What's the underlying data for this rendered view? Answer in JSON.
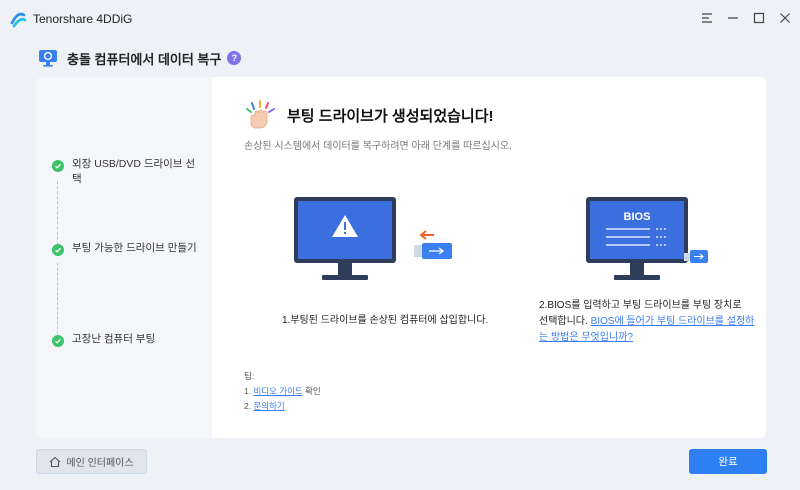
{
  "app": {
    "name": "Tenorshare 4DDiG"
  },
  "header": {
    "title": "충돌 컴퓨터에서 데이터 복구",
    "help": "?"
  },
  "sidebar": {
    "steps": [
      {
        "label": "외장 USB/DVD 드라이브 선택",
        "status": "completed"
      },
      {
        "label": "부팅 가능한 드라이브 만들기",
        "status": "completed"
      },
      {
        "label": "고장난 컴퓨터 부팅",
        "status": "completed"
      }
    ]
  },
  "main": {
    "title": "부팅 드라이브가 생성되었습니다!",
    "description": "손상된 시스템에서 데이터를 복구하려면 아래 단계를 따르십시오.",
    "instructions": [
      {
        "text": "1.부팅된 드라이브를 손상된 컴퓨터에 삽입합니다."
      },
      {
        "text_line1": "2.BIOS를 입력하고 부팅 드라이브를 부팅 장치로",
        "text_line2": "선택합니다.",
        "link": "BIOS에 들어가 부팅 드라이브를 설정하는 방법은 무엇입니까?"
      }
    ],
    "bios_screen_label": "BIOS",
    "tips": {
      "heading": "팁:",
      "items": [
        {
          "prefix": "1. ",
          "link": "비디오 가이드",
          "suffix": " 확인"
        },
        {
          "prefix": "2. ",
          "link": "문의하기",
          "suffix": ""
        }
      ]
    }
  },
  "footer": {
    "home_button": "메인 인터페이스",
    "done_button": "완료"
  },
  "colors": {
    "accent": "#2e7ff2",
    "success": "#3ec26a",
    "help": "#7f73e8",
    "monitor": "#3b6fe0",
    "monitor_frame": "#2e3e5a"
  }
}
